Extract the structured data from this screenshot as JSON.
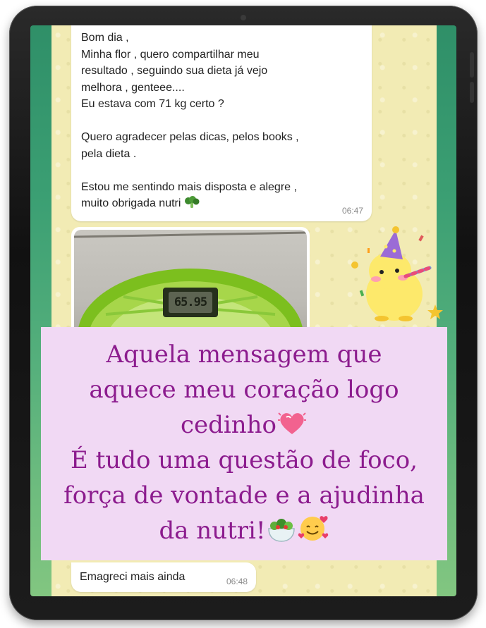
{
  "message_1": {
    "lines": [
      "Bom dia ,",
      "Minha flor , quero compartilhar meu",
      "resultado , seguindo sua dieta já vejo",
      "melhora , genteee....",
      "Eu estava com 71 kg certo ?",
      "",
      "Quero agradecer pelas dicas, pelos books ,",
      "pela dieta .",
      "",
      "Estou me sentindo mais disposta e alegre ,",
      "muito obrigada nutri"
    ],
    "emoji": "broccoli",
    "time": "06:47"
  },
  "photo": {
    "scale_reading": "65.95"
  },
  "sticker": {
    "icon": "party-chick-sticker"
  },
  "overlay": {
    "line_1": "Aquela mensagem que",
    "line_2": "aquece meu coração logo",
    "line_3": "cedinho",
    "line_3_emoji": "sparkling-heart",
    "line_4": "É tudo uma questão de foco,",
    "line_5": "força de vontade e a ajudinha",
    "line_6": "da nutri!",
    "line_6_emojis": [
      "salad",
      "smiling-face-with-hearts"
    ],
    "text_color": "#8c1c8e",
    "background_color": "#f1d9f4"
  },
  "message_2": {
    "text": "Emagreci mais ainda",
    "time": "06:48"
  }
}
